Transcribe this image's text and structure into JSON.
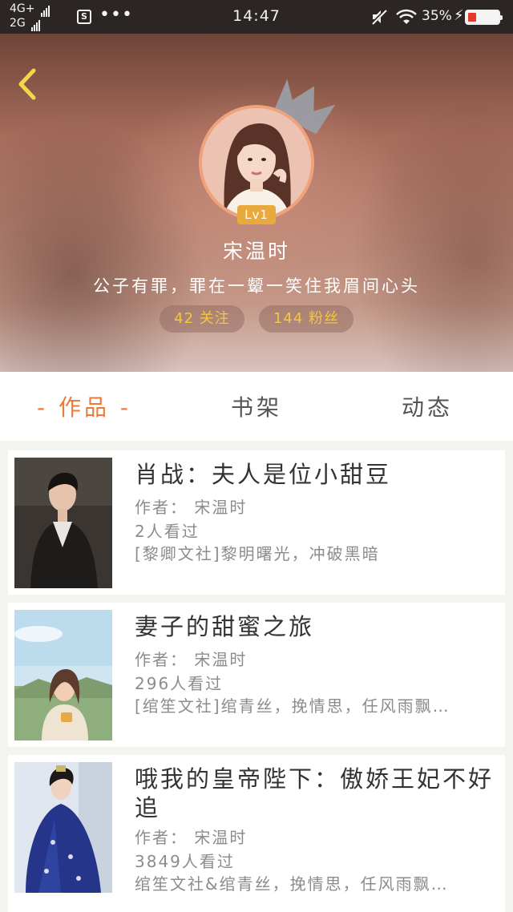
{
  "status_bar": {
    "network_top": "4G+",
    "network_bottom": "2G",
    "sim_label": "S",
    "more": "•••",
    "time": "14:47",
    "battery_percent": "35%",
    "charging_symbol": "⚡"
  },
  "profile": {
    "level": "Lv1",
    "name": "宋温时",
    "motto": "公子有罪，罪在一颦一笑住我眉间心头",
    "follow": "42 关注",
    "fans": "144 粉丝"
  },
  "tabs": {
    "works": "- 作品 -",
    "shelf": "书架",
    "activity": "动态"
  },
  "books": [
    {
      "title": "肖战：夫人是位小甜豆",
      "author": "作者： 宋温时",
      "views": "2人看过",
      "tags": "[黎卿文社]黎明曙光，冲破黑暗"
    },
    {
      "title": "妻子的甜蜜之旅",
      "author": "作者： 宋温时",
      "views": "296人看过",
      "tags": "[绾笙文社]绾青丝，挽情思，任风雨飘…"
    },
    {
      "title": "哦我的皇帝陛下：傲娇王妃不好追",
      "author": "作者： 宋温时",
      "views": "3849人看过",
      "tags": "绾笙文社&绾青丝，挽情思，任风雨飘…"
    }
  ],
  "colors": {
    "accent": "#ee7a3a",
    "gold": "#f2c83d",
    "back_arrow": "#f3d64a"
  }
}
